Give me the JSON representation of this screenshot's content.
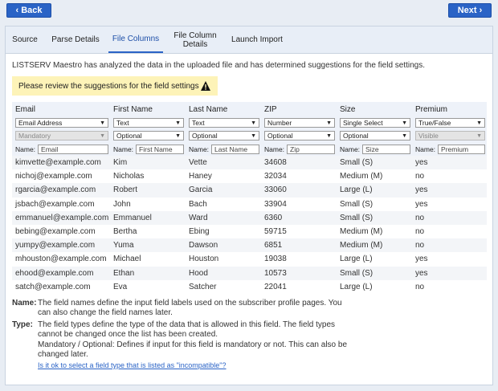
{
  "nav": {
    "back": "‹ Back",
    "next": "Next ›"
  },
  "tabs": [
    "Source",
    "Parse Details",
    "File Columns",
    "File Column Details",
    "Launch Import"
  ],
  "intro": "LISTSERV Maestro has analyzed the data in the uploaded file and has determined suggestions for the field settings.",
  "notice": "Please review the suggestions for the field settings",
  "name_label": "Name:",
  "columns": [
    {
      "header": "Email",
      "type": "Email Address",
      "mandatory": "Mandatory",
      "name": "Email",
      "type_disabled": false,
      "mand_disabled": true
    },
    {
      "header": "First Name",
      "type": "Text",
      "mandatory": "Optional",
      "name": "First Name",
      "type_disabled": false,
      "mand_disabled": false
    },
    {
      "header": "Last Name",
      "type": "Text",
      "mandatory": "Optional",
      "name": "Last Name",
      "type_disabled": false,
      "mand_disabled": false
    },
    {
      "header": "ZIP",
      "type": "Number",
      "mandatory": "Optional",
      "name": "Zip",
      "type_disabled": false,
      "mand_disabled": false
    },
    {
      "header": "Size",
      "type": "Single Select",
      "mandatory": "Optional",
      "name": "Size",
      "type_disabled": false,
      "mand_disabled": false
    },
    {
      "header": "Premium",
      "type": "True/False",
      "mandatory": "Visible",
      "name": "Premium",
      "type_disabled": false,
      "mand_disabled": true
    }
  ],
  "rows": [
    [
      "kimvette@example.com",
      "Kim",
      "Vette",
      "34608",
      "Small (S)",
      "yes"
    ],
    [
      "nichoj@example.com",
      "Nicholas",
      "Haney",
      "32034",
      "Medium (M)",
      "no"
    ],
    [
      "rgarcia@example.com",
      "Robert",
      "Garcia",
      "33060",
      "Large (L)",
      "yes"
    ],
    [
      "jsbach@example.com",
      "John",
      "Bach",
      "33904",
      "Small (S)",
      "yes"
    ],
    [
      "emmanuel@example.com",
      "Emmanuel",
      "Ward",
      "6360",
      "Small (S)",
      "no"
    ],
    [
      "bebing@example.com",
      "Bertha",
      "Ebing",
      "59715",
      "Medium (M)",
      "no"
    ],
    [
      "yumpy@example.com",
      "Yuma",
      "Dawson",
      "6851",
      "Medium (M)",
      "no"
    ],
    [
      "mhouston@example.com",
      "Michael",
      "Houston",
      "19038",
      "Large (L)",
      "yes"
    ],
    [
      "ehood@example.com",
      "Ethan",
      "Hood",
      "10573",
      "Small (S)",
      "yes"
    ],
    [
      "satch@example.com",
      "Eva",
      "Satcher",
      "22041",
      "Large (L)",
      "no"
    ]
  ],
  "footer": {
    "name_label": "Name:",
    "name_text": "The field names define the input field labels used on the subscriber profile pages. You can also change the field names later.",
    "type_label": "Type:",
    "type_text": "The field types define the type of the data that is allowed in this field. The field types cannot be changed once the list has been created.",
    "mandatory_text": "Mandatory / Optional: Defines if input for this field is mandatory or not. This can also be changed later.",
    "link": "Is it ok to select a field type that is listed as \"incompatible\"?"
  },
  "colors": {
    "accent": "#2a63c6",
    "notice_bg": "#fdf3b8",
    "header_bg": "#eef2f9"
  }
}
